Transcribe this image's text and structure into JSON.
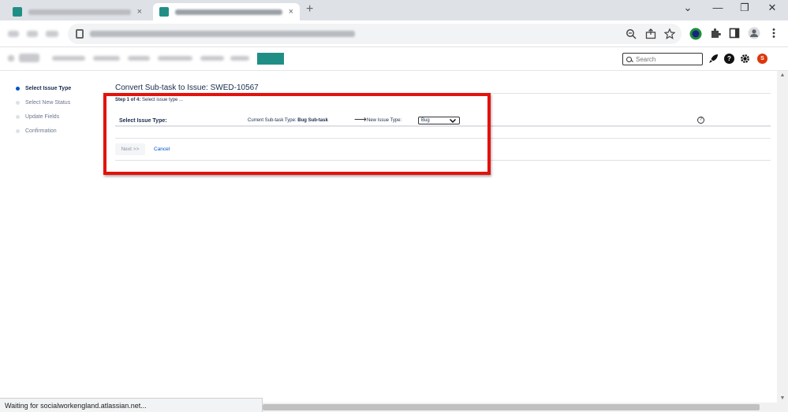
{
  "browser": {
    "new_tab_glyph": "+",
    "close_tab_glyph": "×",
    "window_controls": {
      "chevron": "⌄",
      "minimize": "—",
      "restore": "❐",
      "close": "✕"
    }
  },
  "search": {
    "placeholder": "Search"
  },
  "header": {
    "help_glyph": "?",
    "avatar_initial": "S"
  },
  "steps": [
    {
      "label": "Select Issue Type",
      "current": true
    },
    {
      "label": "Select New Status",
      "current": false
    },
    {
      "label": "Update Fields",
      "current": false
    },
    {
      "label": "Confirmation",
      "current": false
    }
  ],
  "main": {
    "title": "Convert Sub-task to Issue: SWED-10567",
    "step_prefix": "Step 1 of 4:",
    "step_text": "Select issue type ...",
    "select_issue_type_label": "Select Issue Type:",
    "current_type_label": "Current Sub-task Type:",
    "current_type_value": "Bug Sub-task",
    "arrow": "⟶",
    "new_issue_type_label": "New Issue Type:",
    "new_issue_type_value": "Bug",
    "help_glyph": "?",
    "next_label": "Next >>",
    "cancel_label": "Cancel"
  },
  "status_bar": {
    "text": "Waiting for socialworkengland.atlassian.net..."
  },
  "colors": {
    "accent_teal": "#1f8f86",
    "highlight_red": "#e3120b",
    "link_blue": "#0052cc",
    "avatar_red": "#de350b"
  }
}
